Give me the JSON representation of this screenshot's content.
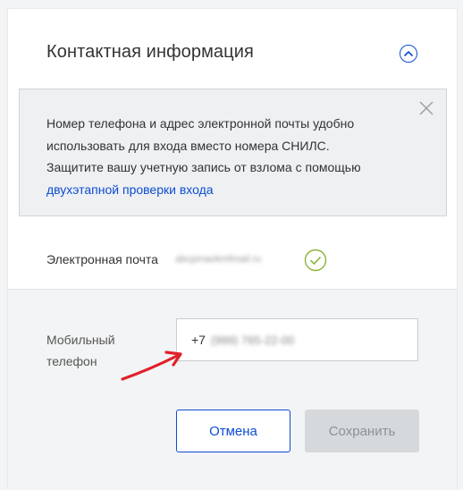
{
  "section": {
    "title": "Контактная информация"
  },
  "info": {
    "line1": "Номер телефона и адрес электронной почты удобно",
    "line2": "использовать для входа вместо номера СНИЛС.",
    "line3": "Защитите вашу учетную запись от взлома с помощью",
    "link": "двухэтапной проверки входа"
  },
  "email": {
    "label": "Электронная почта",
    "value": "abcpmaokmfmail.ru"
  },
  "phone": {
    "label_line1": "Мобильный",
    "label_line2": "телефон",
    "prefix": "+7",
    "value": "(999) 765-22-00"
  },
  "buttons": {
    "cancel": "Отмена",
    "save": "Сохранить"
  },
  "colors": {
    "accent": "#0d4cd3",
    "check": "#8ab33a",
    "annotation_arrow": "#e0202a"
  }
}
